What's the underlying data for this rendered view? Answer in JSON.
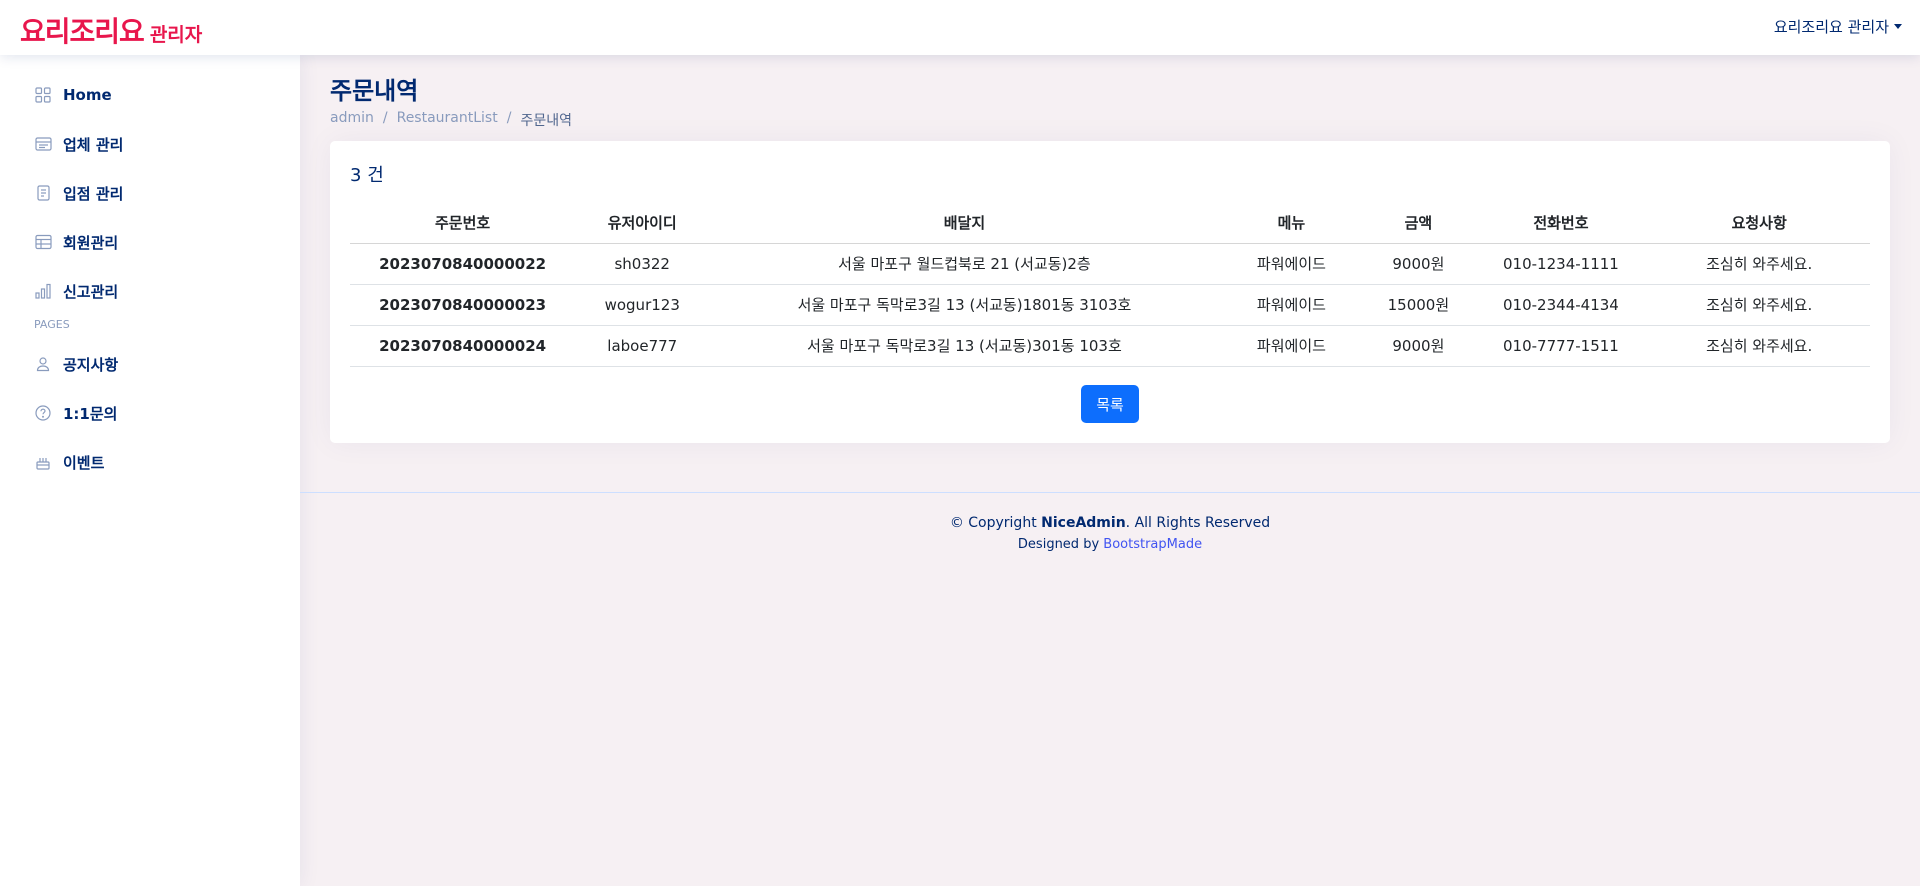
{
  "header": {
    "logo_main": "요리조리요",
    "logo_sub": "관리자",
    "profile_name": "요리조리요 관리자"
  },
  "sidebar": {
    "items": [
      {
        "label": "Home",
        "icon": "grid-icon"
      },
      {
        "label": "업체 관리",
        "icon": "layout-text-icon"
      },
      {
        "label": "입점 관리",
        "icon": "journal-text-icon"
      },
      {
        "label": "회원관리",
        "icon": "table-icon"
      },
      {
        "label": "신고관리",
        "icon": "bar-chart-icon"
      }
    ],
    "heading": "PAGES",
    "pages": [
      {
        "label": "공지사항",
        "icon": "person-icon"
      },
      {
        "label": "1:1문의",
        "icon": "question-circle-icon"
      },
      {
        "label": "이벤트",
        "icon": "cake-icon"
      }
    ]
  },
  "page": {
    "title": "주문내역",
    "breadcrumb": [
      "admin",
      "RestaurantList",
      "주문내역"
    ]
  },
  "card": {
    "count_number": "3",
    "count_unit": "건",
    "columns": [
      "주문번호",
      "유저아이디",
      "배달지",
      "메뉴",
      "금액",
      "전화번호",
      "요청사항"
    ],
    "rows": [
      [
        "2023070840000022",
        "sh0322",
        "서울 마포구 월드컵북로 21 (서교동)2층",
        "파워에이드",
        "9000원",
        "010-1234-1111",
        "조심히 와주세요."
      ],
      [
        "2023070840000023",
        "wogur123",
        "서울 마포구 독막로3길 13 (서교동)1801동 3103호",
        "파워에이드",
        "15000원",
        "010-2344-4134",
        "조심히 와주세요."
      ],
      [
        "2023070840000024",
        "laboe777",
        "서울 마포구 독막로3길 13 (서교동)301동 103호",
        "파워에이드",
        "9000원",
        "010-7777-1511",
        "조심히 와주세요."
      ]
    ],
    "list_button": "목록"
  },
  "footer": {
    "copyright_prefix": "© Copyright",
    "brand": "NiceAdmin",
    "copyright_suffix": ". All Rights Reserved",
    "designed_by": "Designed by",
    "designer": "BootstrapMade"
  },
  "colors": {
    "brand": "#e8164c",
    "nav": "#012970",
    "primary_button": "#0d6efd"
  }
}
